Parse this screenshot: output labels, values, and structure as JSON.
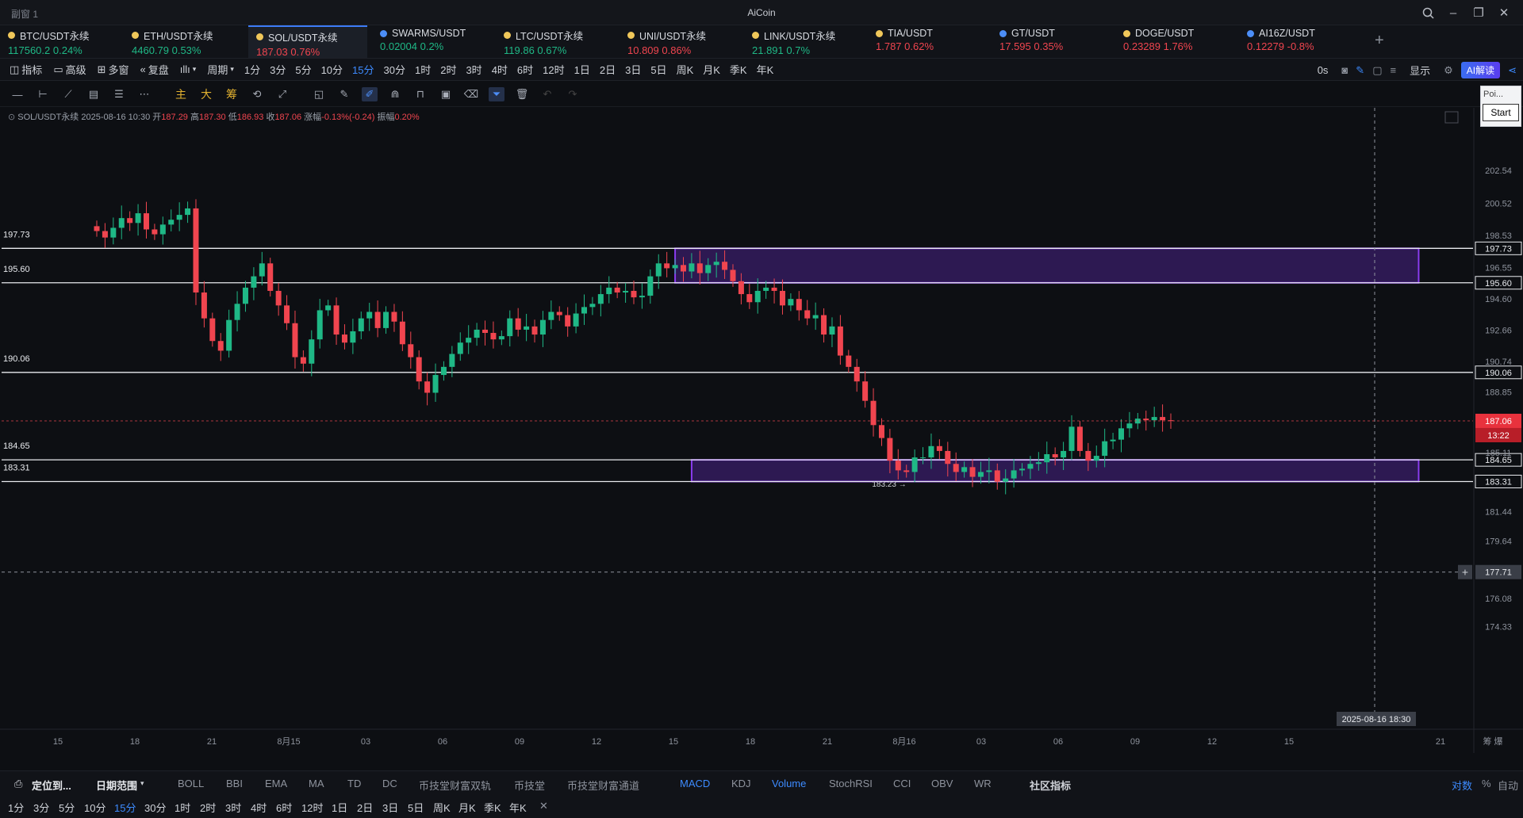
{
  "window": {
    "name": "副窗 1",
    "app_title": "AiCoin",
    "search_icon": "search-icon",
    "minimize": "–",
    "restore": "❐",
    "close": "✕"
  },
  "tickers": [
    {
      "name": "BTC/USDT永续",
      "price": "117560.2",
      "change": "0.24%",
      "dir": "up",
      "icon": "coin-dot-icon"
    },
    {
      "name": "ETH/USDT永续",
      "price": "4460.79",
      "change": "0.53%",
      "dir": "up",
      "icon": "coin-dot-icon"
    },
    {
      "name": "SOL/USDT永续",
      "price": "187.03",
      "change": "0.76%",
      "dir": "dn",
      "icon": "coin-dot-icon",
      "active": true
    },
    {
      "name": "SWARMS/USDT",
      "price": "0.02004",
      "change": "0.2%",
      "dir": "up",
      "icon": "exchange-dot-icon"
    },
    {
      "name": "LTC/USDT永续",
      "price": "119.86",
      "change": "0.67%",
      "dir": "up",
      "icon": "coin-dot-icon"
    },
    {
      "name": "UNI/USDT永续",
      "price": "10.809",
      "change": "0.86%",
      "dir": "dn",
      "icon": "coin-dot-icon"
    },
    {
      "name": "LINK/USDT永续",
      "price": "21.891",
      "change": "0.7%",
      "dir": "up",
      "icon": "coin-dot-icon"
    },
    {
      "name": "TIA/USDT",
      "price": "1.787",
      "change": "0.62%",
      "dir": "dn",
      "icon": "coin-dot-icon"
    },
    {
      "name": "GT/USDT",
      "price": "17.595",
      "change": "0.35%",
      "dir": "dn",
      "icon": "exchange-dot-icon"
    },
    {
      "name": "DOGE/USDT",
      "price": "0.23289",
      "change": "1.76%",
      "dir": "dn",
      "icon": "coin-dot-icon"
    },
    {
      "name": "AI16Z/USDT",
      "price": "0.12279",
      "change": "-0.8%",
      "dir": "dn",
      "icon": "exchange-dot-icon"
    }
  ],
  "add_tab": "+",
  "toolbar": {
    "indicator": "指标",
    "advanced": "高级",
    "multi": "多窗",
    "replay": "复盘",
    "period": "周期",
    "intervals": [
      "1分",
      "3分",
      "5分",
      "10分",
      "15分",
      "30分",
      "1时",
      "2时",
      "3时",
      "4时",
      "6时",
      "12时",
      "1日",
      "2日",
      "3日",
      "5日",
      "周K",
      "月K",
      "季K",
      "年K"
    ],
    "selected_interval": "15分",
    "delay": "0s",
    "display": "显示",
    "ai": "AI解读"
  },
  "drawing_tools": {
    "main": "主",
    "big": "大",
    "chip": "筹"
  },
  "popup": {
    "title": "Poi...",
    "button": "Start"
  },
  "ohlc": {
    "symbol": "SOL/USDT永续",
    "time": "2025-08-16 10:30",
    "open_label": "开",
    "open": "187.29",
    "high_label": "高",
    "high": "187.30",
    "low_label": "低",
    "low": "186.93",
    "close_label": "收",
    "close": "187.06",
    "change_label": "涨幅",
    "change": "-0.13%(-0.24)",
    "amp_label": "振幅",
    "amp": "0.20%"
  },
  "chart_data": {
    "type": "candlestick",
    "price_axis_ticks": [
      "202.54",
      "200.52",
      "198.53",
      "196.55",
      "194.60",
      "192.66",
      "190.74",
      "188.85",
      "185.11",
      "181.44",
      "179.64",
      "176.08",
      "174.33"
    ],
    "time_axis_ticks": [
      "15",
      "18",
      "21",
      "8月15",
      "03",
      "06",
      "09",
      "12",
      "15",
      "18",
      "21",
      "8月16",
      "03",
      "06",
      "09",
      "12",
      "15",
      "21"
    ],
    "horizontal_levels": [
      {
        "value": 197.73,
        "label": "197.73"
      },
      {
        "value": 195.6,
        "label": "195.60"
      },
      {
        "value": 190.06,
        "label": "190.06"
      },
      {
        "value": 184.65,
        "label": "184.65"
      },
      {
        "value": 183.31,
        "label": "183.31"
      }
    ],
    "zones": [
      {
        "from": 195.6,
        "to": 197.73,
        "start_index": 70,
        "end_index": 160
      },
      {
        "from": 183.31,
        "to": 184.65,
        "start_index": 72,
        "end_index": 160
      }
    ],
    "current_price": "187.06",
    "countdown": "13:22",
    "crosshair_price": "177.71",
    "crosshair_time": "2025-08-16 18:30",
    "low_marker": "183.23",
    "grid": false,
    "closes": [
      198.8,
      198.4,
      199.0,
      199.6,
      199.3,
      199.9,
      198.9,
      198.6,
      199.2,
      199.5,
      199.8,
      200.2,
      195.0,
      193.4,
      192.0,
      191.4,
      193.3,
      194.3,
      195.3,
      196.0,
      196.8,
      195.1,
      194.2,
      193.1,
      191.0,
      190.6,
      192.1,
      193.9,
      194.2,
      192.4,
      191.9,
      192.6,
      193.4,
      193.8,
      192.8,
      193.8,
      193.2,
      191.8,
      191.0,
      189.5,
      188.8,
      189.9,
      190.4,
      191.2,
      191.9,
      192.2,
      192.7,
      192.5,
      192.1,
      192.3,
      193.4,
      192.7,
      192.9,
      192.4,
      193.3,
      193.8,
      193.6,
      192.9,
      193.7,
      194.1,
      194.3,
      194.9,
      195.3,
      195.0,
      195.1,
      194.7,
      194.8,
      196.0,
      196.8,
      196.5,
      196.7,
      196.3,
      196.8,
      196.2,
      196.7,
      196.9,
      196.4,
      195.7,
      194.9,
      194.4,
      195.1,
      195.3,
      195.1,
      194.2,
      194.6,
      193.9,
      193.4,
      193.6,
      192.4,
      192.9,
      191.1,
      190.4,
      189.5,
      188.3,
      186.8,
      186.0,
      184.6,
      184.0,
      183.9,
      184.8,
      184.8,
      185.5,
      185.2,
      184.4,
      183.9,
      184.2,
      183.6,
      183.9,
      184.0,
      183.3,
      183.5,
      184.0,
      184.1,
      184.4,
      184.5,
      185.0,
      184.8,
      185.2,
      186.7,
      185.2,
      184.6,
      184.9,
      185.8,
      185.9,
      186.6,
      186.9,
      187.2,
      187.1,
      187.3,
      187.1,
      187.06
    ]
  },
  "bottom": {
    "locate": "定位到...",
    "date_range": "日期范围",
    "indicators": [
      "BOLL",
      "BBI",
      "EMA",
      "MA",
      "TD",
      "DC",
      "币技堂财富双轨",
      "币技堂",
      "币技堂财富通道"
    ],
    "sub_indicators": [
      "MACD",
      "KDJ",
      "Volume",
      "StochRSI",
      "CCI",
      "OBV",
      "WR",
      "社区指标"
    ],
    "selected_sub": "Volume",
    "right": [
      "对数",
      "%",
      "自动"
    ],
    "intervals": [
      "1分",
      "3分",
      "5分",
      "10分",
      "15分",
      "30分",
      "1时",
      "2时",
      "3时",
      "4时",
      "6时",
      "12时",
      "1日",
      "2日",
      "3日",
      "5日",
      "周K",
      "月K",
      "季K",
      "年K"
    ],
    "selected_interval": "15分",
    "close_icon": "✕"
  }
}
